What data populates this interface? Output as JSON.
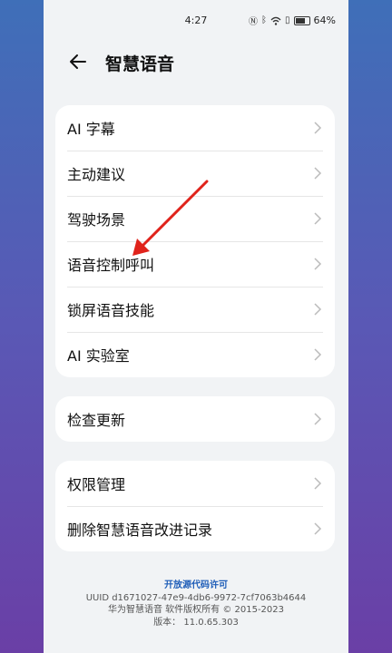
{
  "status": {
    "time": "4:27",
    "battery": "64%",
    "battery_level": 0.64
  },
  "header": {
    "title": "智慧语音"
  },
  "groups": [
    {
      "items": [
        {
          "label": "AI 字幕"
        },
        {
          "label": "主动建议"
        },
        {
          "label": "驾驶场景"
        },
        {
          "label": "语音控制呼叫"
        },
        {
          "label": "锁屏语音技能"
        },
        {
          "label": "AI 实验室"
        }
      ]
    },
    {
      "items": [
        {
          "label": "检查更新"
        }
      ]
    },
    {
      "items": [
        {
          "label": "权限管理"
        },
        {
          "label": "删除智慧语音改进记录"
        }
      ]
    }
  ],
  "footer": {
    "link": "开放源代码许可",
    "uuid": "UUID d1671027-47e9-4db6-9972-7cf7063b4644",
    "copyright": "华为智慧语音 软件版权所有 © 2015-2023",
    "version": "版本： 11.0.65.303"
  },
  "colors": {
    "accent_link": "#1e5db8",
    "annotation_arrow": "#e0231b"
  },
  "icons": [
    "back-arrow-icon",
    "chevron-right-icon",
    "nfc-icon",
    "bluetooth-icon",
    "wifi-icon",
    "battery-icon"
  ]
}
